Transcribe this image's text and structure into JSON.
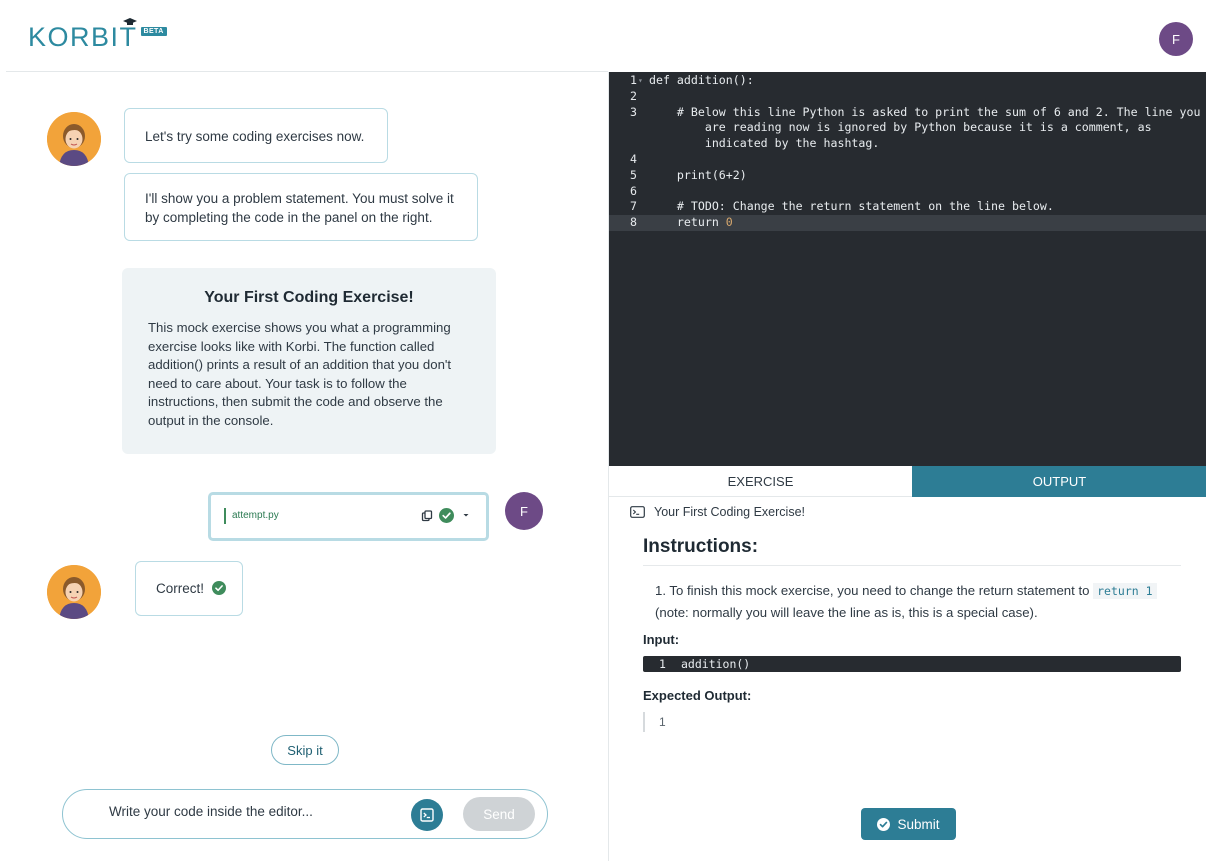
{
  "header": {
    "logo_text": "KORBIT",
    "beta_badge": "BETA",
    "user_initial": "F"
  },
  "chat": {
    "messages": [
      {
        "text": "Let's try some coding exercises now."
      },
      {
        "text": "I'll show you a problem statement. You must solve it by completing the code in the panel on the right."
      }
    ],
    "exercise_card": {
      "title": "Your First Coding Exercise!",
      "body": "This mock exercise shows you what a programming exercise looks like with Korbi. The function called addition() prints a result of an addition that you don't need to care about. Your task is to follow the instructions, then submit the code and observe the output in the console."
    },
    "attempt": {
      "filename": "attempt.py",
      "user_initial": "F"
    },
    "correct_text": "Correct!",
    "skip_label": "Skip it",
    "composer": {
      "placeholder": "Write your code inside the editor...",
      "send_label": "Send"
    }
  },
  "editor": {
    "lines": [
      {
        "num": "1",
        "fold": true,
        "code": "def addition():"
      },
      {
        "num": "2",
        "code": ""
      },
      {
        "num": "3",
        "code": "    # Below this line Python is asked to print the sum of 6 and 2. The line you"
      },
      {
        "num": "",
        "code": "        are reading now is ignored by Python because it is a comment, as"
      },
      {
        "num": "",
        "code": "        indicated by the hashtag."
      },
      {
        "num": "4",
        "code": ""
      },
      {
        "num": "5",
        "code": "    print(6+2)"
      },
      {
        "num": "6",
        "code": ""
      },
      {
        "num": "7",
        "code": "    # TODO: Change the return statement on the line below."
      },
      {
        "num": "8",
        "code": "    return ",
        "tail": "0",
        "active": true
      }
    ]
  },
  "tabs": {
    "exercise": "EXERCISE",
    "output": "OUTPUT"
  },
  "output": {
    "heading": "Your First Coding Exercise!",
    "instructions_title": "Instructions:",
    "instruction_prefix": "1. To finish this mock exercise, you need to change the return statement to ",
    "instruction_code": "return 1",
    "instruction_suffix": " (note: normally you will leave the line as is, this is a special case).",
    "input_label": "Input:",
    "input_line_num": "1",
    "input_code": "addition()",
    "expected_label": "Expected Output:",
    "expected_value": "1",
    "submit_label": "Submit"
  },
  "colors": {
    "brand": "#2d8aa0",
    "accent": "#2d7d95",
    "success": "#3f8c5c",
    "avatar": "#6d4a86",
    "editor_bg": "#272b30"
  }
}
